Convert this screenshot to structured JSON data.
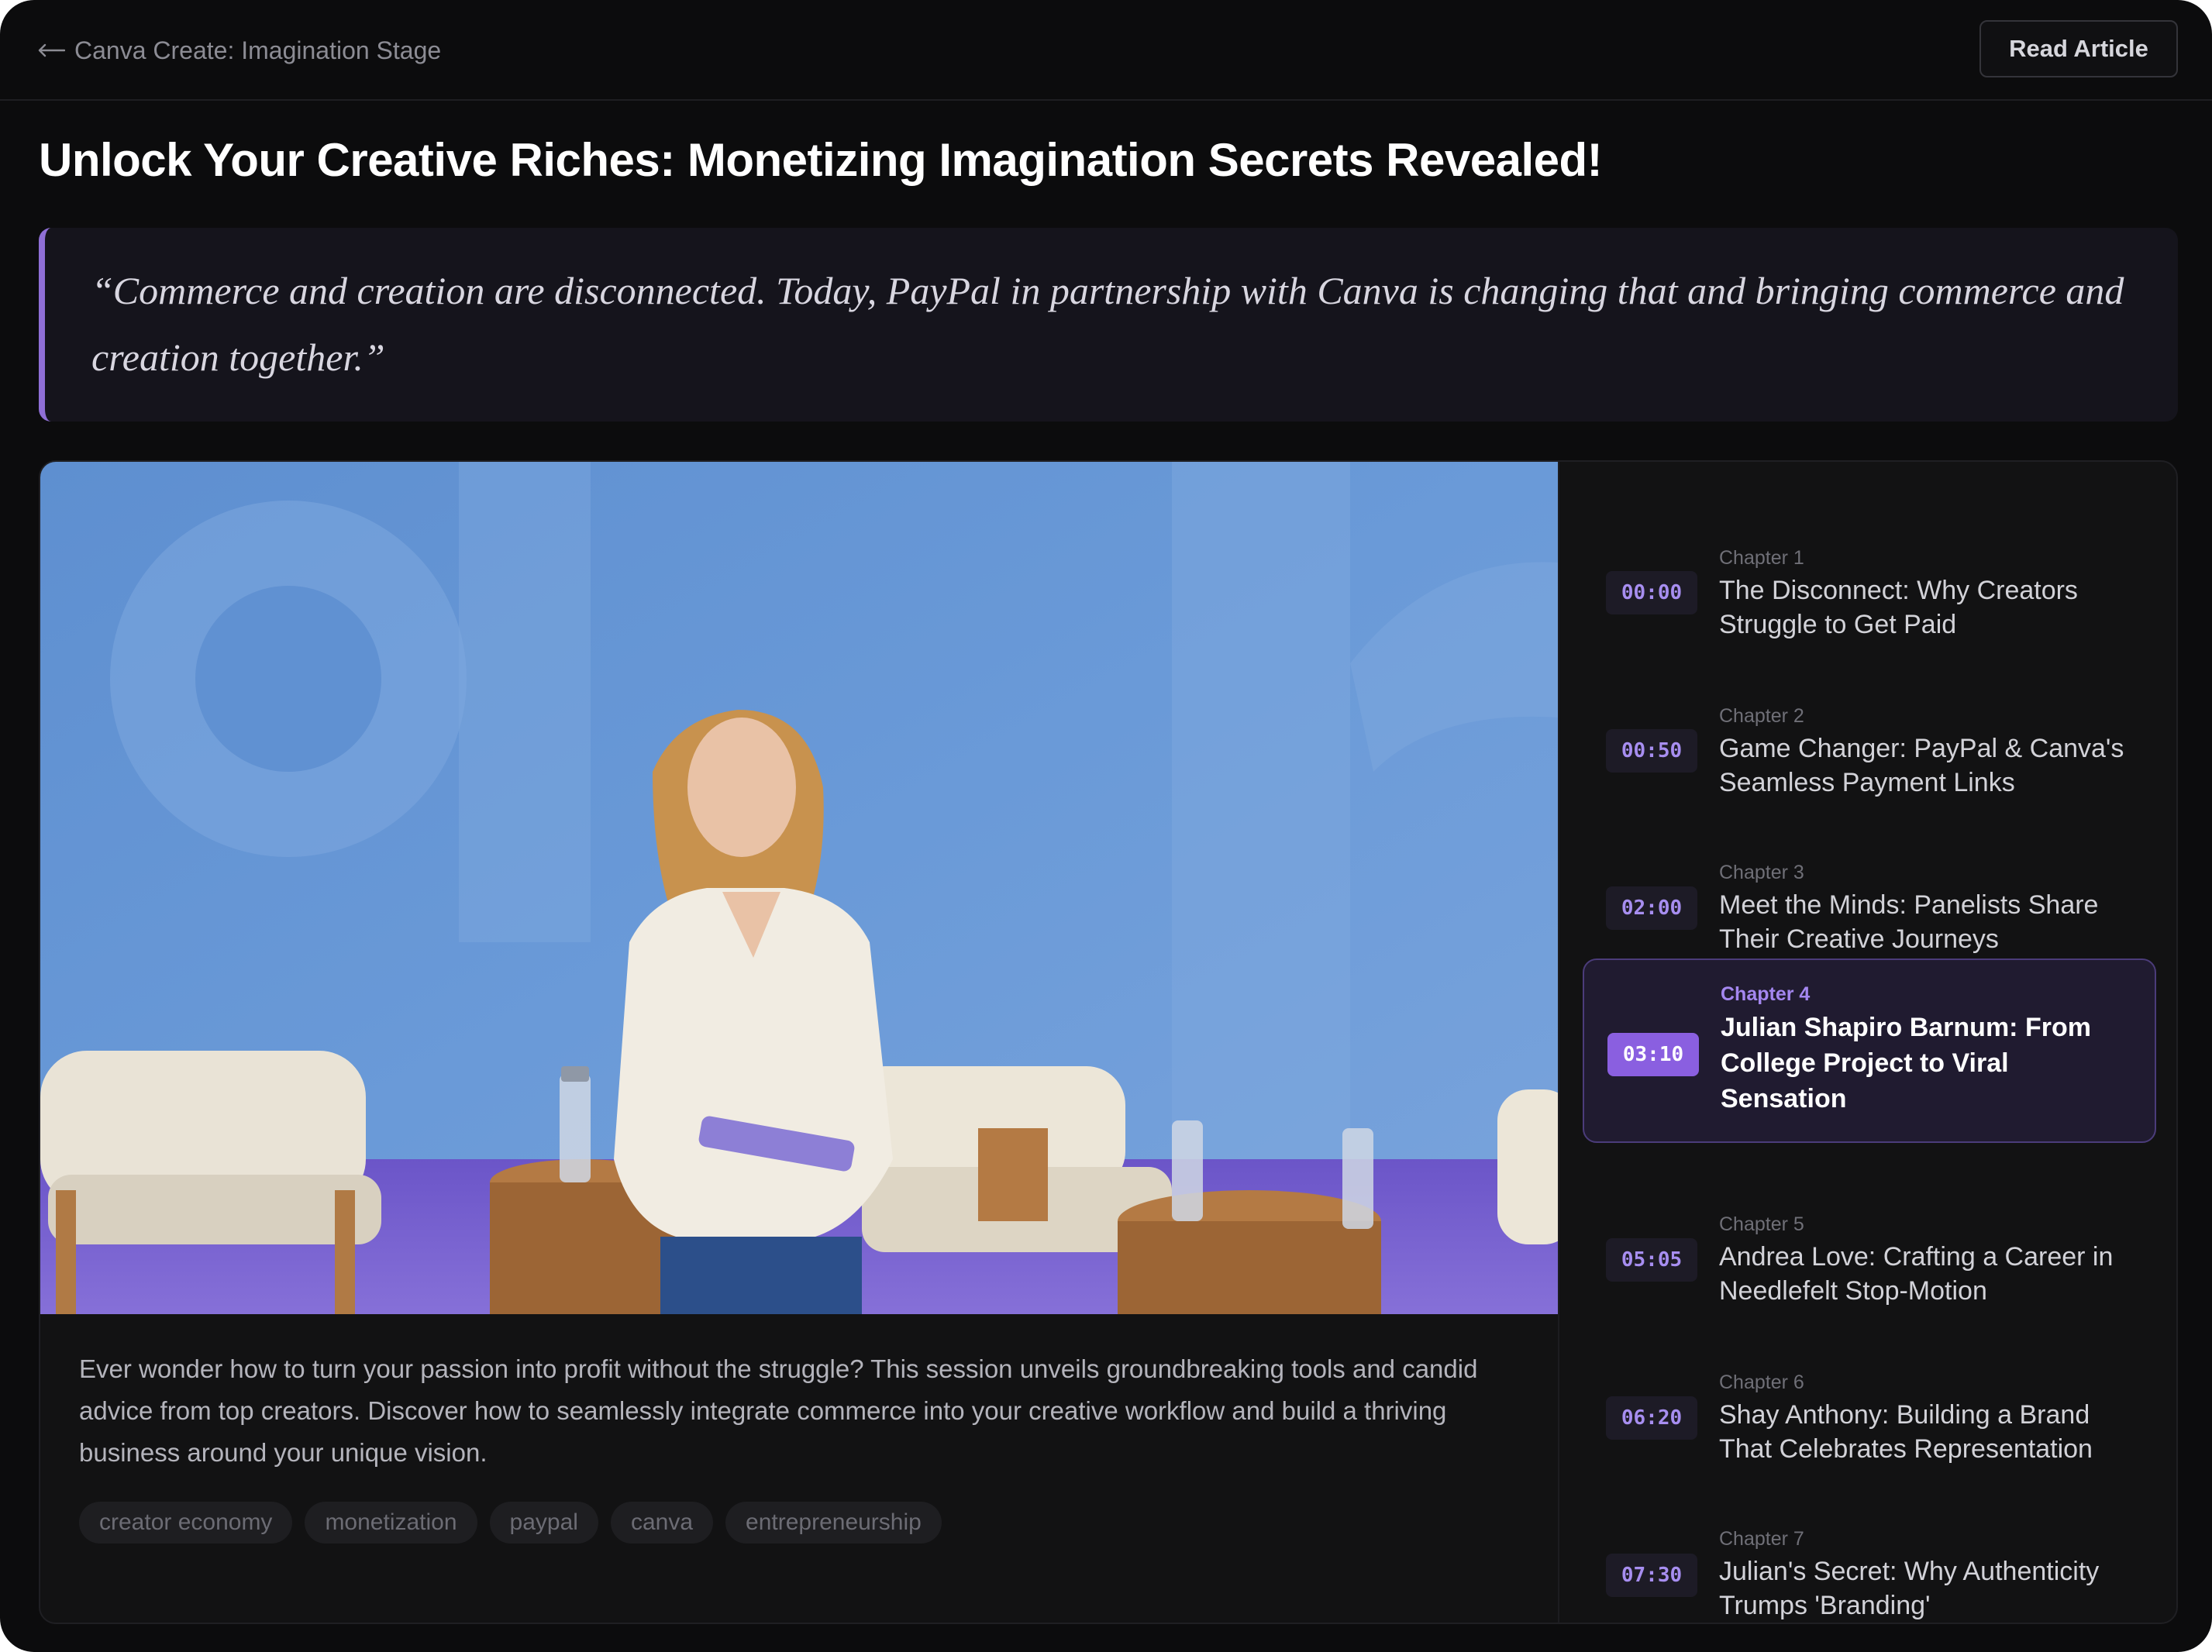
{
  "header": {
    "back_label": "Canva Create: Imagination Stage",
    "read_button": "Read Article"
  },
  "title": "Unlock Your Creative Riches: Monetizing Imagination Secrets Revealed!",
  "quote": "“Commerce and creation are disconnected. Today, PayPal in partnership with Canva is changing that and bringing commerce and creation together.”",
  "video": {
    "description": "Ever wonder how to turn your passion into profit without the struggle? This session unveils groundbreaking tools and candid advice from top creators. Discover how to seamlessly integrate commerce into your creative workflow and build a thriving business around your unique vision."
  },
  "tags": [
    "creator economy",
    "monetization",
    "paypal",
    "canva",
    "entrepreneurship"
  ],
  "chapters": [
    {
      "label": "Chapter 1",
      "time": "00:00",
      "title": "The Disconnect: Why Creators Struggle to Get Paid",
      "active": false
    },
    {
      "label": "Chapter 2",
      "time": "00:50",
      "title": "Game Changer: PayPal & Canva's Seamless Payment Links",
      "active": false
    },
    {
      "label": "Chapter 3",
      "time": "02:00",
      "title": "Meet the Minds: Panelists Share Their Creative Journeys",
      "active": false
    },
    {
      "label": "Chapter 4",
      "time": "03:10",
      "title": "Julian Shapiro Barnum: From College Project to Viral Sensation",
      "active": true
    },
    {
      "label": "Chapter 5",
      "time": "05:05",
      "title": "Andrea Love: Crafting a Career in Needlefelt Stop-Motion",
      "active": false
    },
    {
      "label": "Chapter 6",
      "time": "06:20",
      "title": "Shay Anthony: Building a Brand That Celebrates Representation",
      "active": false
    },
    {
      "label": "Chapter 7",
      "time": "07:30",
      "title": "Julian's Secret: Why Authenticity Trumps 'Branding'",
      "active": false
    }
  ],
  "colors": {
    "accent": "#8a5fe0",
    "background": "#0c0c0d",
    "card": "#121213",
    "quote_border": "#8f6fd6"
  }
}
